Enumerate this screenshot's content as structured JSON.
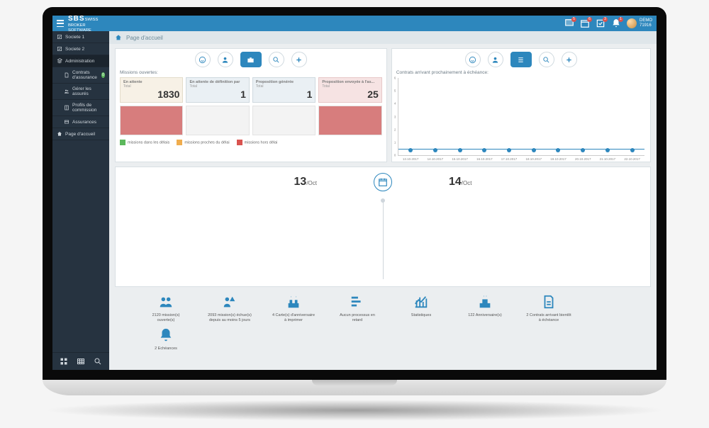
{
  "header": {
    "logo_main": "SBS",
    "logo_sub": "SWISS\nBROKER\nSOFTWARE",
    "notif1": "5",
    "notif2": "6",
    "notif3": "3",
    "notif4": "1",
    "user_name": "DEMO",
    "user_id": "71916"
  },
  "sidebar": {
    "items": [
      {
        "label": "Societe 1"
      },
      {
        "label": "Societe 2"
      },
      {
        "label": "Administration"
      },
      {
        "label": "Contrats d'assurance",
        "badge": "0"
      },
      {
        "label": "Gérer les assurés"
      },
      {
        "label": "Profils de commission"
      },
      {
        "label": "Assurances"
      },
      {
        "label": "Page d'accueil"
      }
    ]
  },
  "crumb": {
    "title": "Page d'accueil"
  },
  "missions": {
    "title": "Missions ouvertes:",
    "cards": [
      {
        "label": "En attente",
        "sub": "Total",
        "num": "1830"
      },
      {
        "label": "En attente de définition par",
        "sub": "Total",
        "num": "1"
      },
      {
        "label": "Proposition générée",
        "sub": "Total",
        "num": "1"
      },
      {
        "label": "Proposition envoyée à l'as...",
        "sub": "Total",
        "num": "25"
      }
    ],
    "legend": [
      "missions dans les délais",
      "missions proches du délai",
      "missions hors délai"
    ]
  },
  "contracts": {
    "title": "Contrats arrivant prochainement à échéance:"
  },
  "chart_data": {
    "type": "line",
    "categories": [
      "13.10.2017",
      "14.10.2017",
      "15.10.2017",
      "16.10.2017",
      "17.10.2017",
      "18.10.2017",
      "19.10.2017",
      "20.10.2017",
      "21.10.2017",
      "22.10.2017"
    ],
    "values": [
      0,
      0,
      0,
      0,
      0,
      0,
      0,
      0,
      0,
      0
    ],
    "ylim": [
      0,
      6
    ],
    "yticks": [
      0,
      1,
      2,
      3,
      4,
      5,
      6
    ],
    "xlabel": "",
    "ylabel": ""
  },
  "calendar": {
    "d1": "13",
    "m1": "/Oct",
    "d2": "14",
    "m2": "/Oct"
  },
  "stats": [
    {
      "label": "2120 mission(s) ouverte(s)"
    },
    {
      "label": "2093 mission(s) échue(s) depuis au moins 5 jours"
    },
    {
      "label": "4 Carte(s) d'anniversaire à imprimer"
    },
    {
      "label": "Aucun processus en retard"
    },
    {
      "label": "Statistiques"
    },
    {
      "label": "122 Anniversaire(s)"
    },
    {
      "label": "2 Contrats arrivant bientôt à échéance"
    },
    {
      "label": "2 Echéances"
    }
  ]
}
